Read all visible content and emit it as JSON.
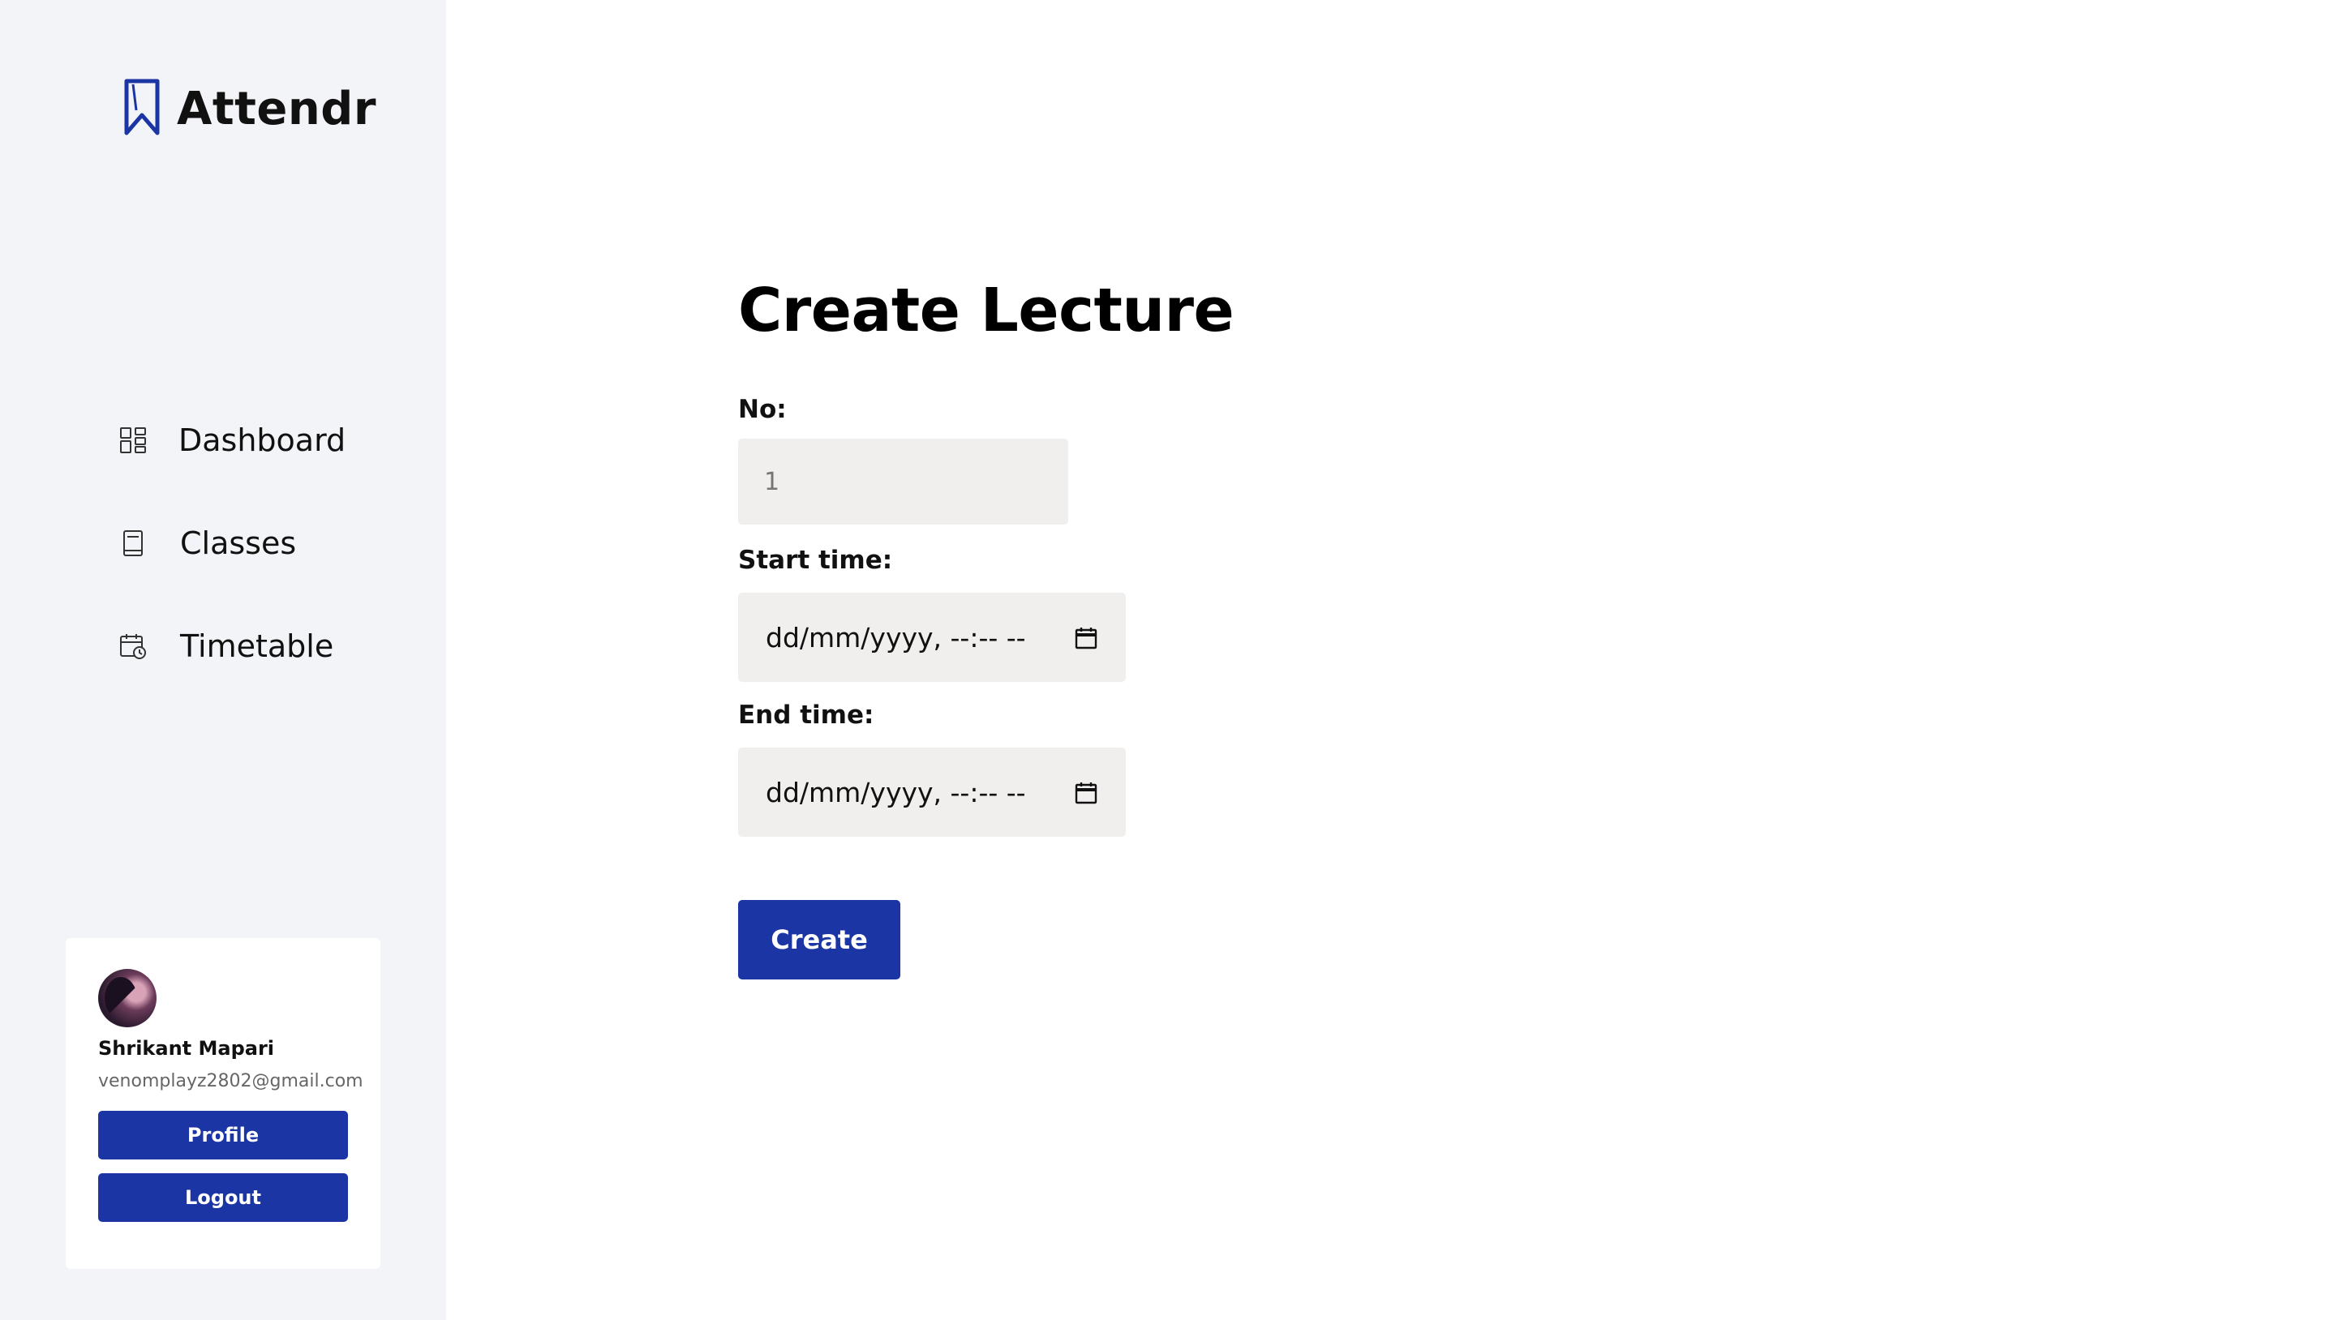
{
  "brand": {
    "name": "Attendr",
    "accent": "#1c35a4"
  },
  "sidebar": {
    "items": [
      {
        "label": "Dashboard",
        "icon": "dashboard-grid-icon"
      },
      {
        "label": "Classes",
        "icon": "book-icon"
      },
      {
        "label": "Timetable",
        "icon": "calendar-clock-icon"
      }
    ]
  },
  "user": {
    "name": "Shrikant Mapari",
    "email": "venomplayz2802@gmail.com",
    "profile_label": "Profile",
    "logout_label": "Logout"
  },
  "form": {
    "title": "Create Lecture",
    "no_label": "No:",
    "no_placeholder": "1",
    "start_label": "Start time:",
    "start_value": "dd/mm/yyyy, --:-- --",
    "end_label": "End time:",
    "end_value": "dd/mm/yyyy, --:-- --",
    "submit_label": "Create"
  }
}
